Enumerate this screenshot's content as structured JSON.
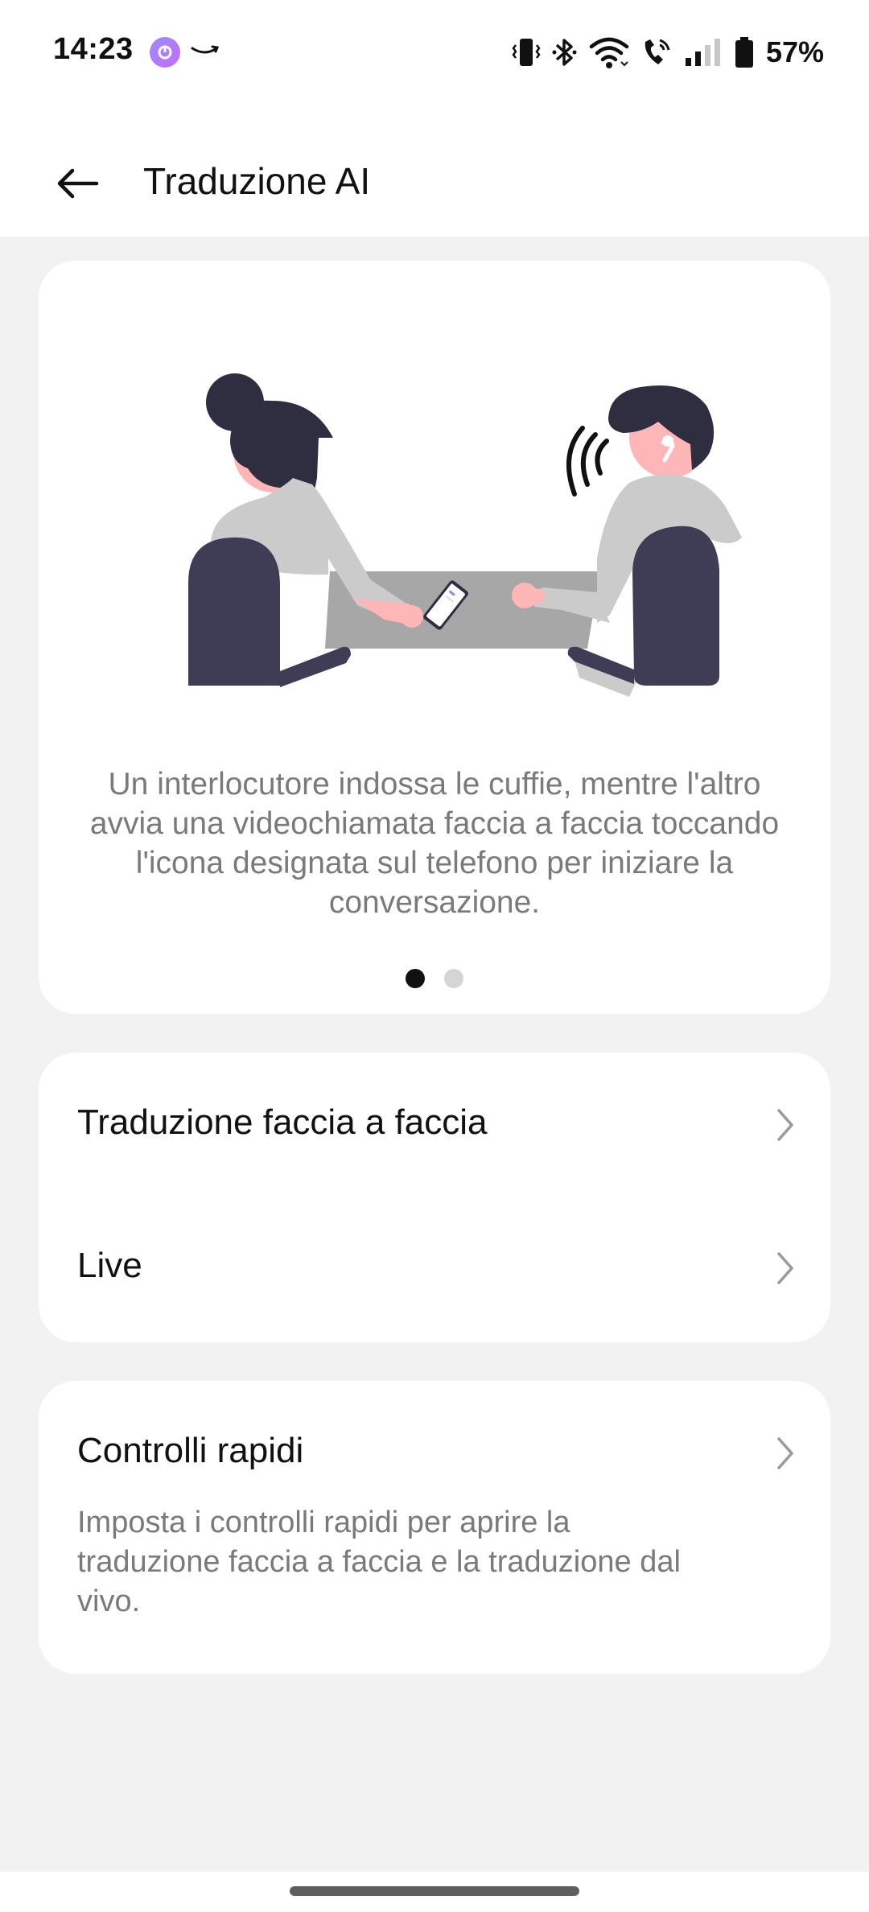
{
  "status_bar": {
    "time": "14:23",
    "battery": "57%",
    "icons": [
      "app-icon",
      "amazon-icon",
      "vibrate-icon",
      "bluetooth-icon",
      "wifi-icon",
      "wifi-call-icon",
      "signal-icon",
      "battery-icon"
    ]
  },
  "header": {
    "title": "Traduzione AI",
    "back_icon": "arrow-left-icon"
  },
  "hero": {
    "description": "Un interlocutore indossa le cuffie, mentre l'altro avvia una videochiamata faccia a faccia toccando l'icona designata sul telefono per iniziare la conversazione.",
    "pagination": {
      "current": 1,
      "total": 2
    }
  },
  "menu": {
    "face_to_face": "Traduzione faccia a faccia",
    "live": "Live",
    "quick_controls": "Controlli rapidi",
    "quick_controls_sub": "Imposta i controlli rapidi per aprire la traduzione faccia a faccia e la traduzione dal vivo."
  },
  "colors": {
    "background": "#f2f2f2",
    "card": "#ffffff",
    "secondary_text": "#7a7a7a",
    "illustration_dark": "#3f3d56",
    "illustration_hair": "#2f2e41",
    "illustration_skin": "#ffb6b6",
    "illustration_gray": "#cbcbcb"
  }
}
